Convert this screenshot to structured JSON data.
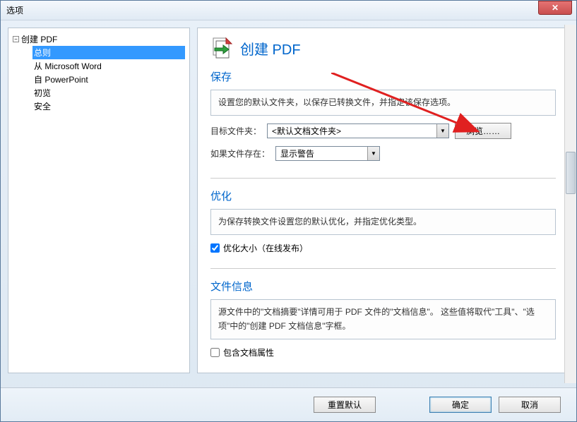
{
  "titlebar": {
    "title": "选项"
  },
  "tree": {
    "root": "创建 PDF",
    "items": [
      "总则",
      "从 Microsoft Word",
      "自 PowerPoint",
      "初览",
      "安全"
    ],
    "selected_index": 0
  },
  "header": {
    "title": "创建 PDF"
  },
  "save": {
    "title": "保存",
    "desc": "设置您的默认文件夹，以保存已转换文件，并指定该保存选项。",
    "target_label": "目标文件夹：",
    "target_value": "<默认文档文件夹>",
    "browse_label": "浏览……",
    "exists_label": "如果文件存在：",
    "exists_value": "显示警告"
  },
  "optimize": {
    "title": "优化",
    "desc": "为保存转换文件设置您的默认优化，并指定优化类型。",
    "chk_size_label": "优化大小（在线发布）",
    "chk_size_checked": true
  },
  "fileinfo": {
    "title": "文件信息",
    "desc": "源文件中的\"文档摘要\"详情可用于 PDF 文件的\"文档信息\"。 这些值将取代\"工具\"、\"选项\"中的\"创建 PDF 文档信息\"字框。",
    "chk_include_label": "包含文档属性",
    "chk_include_checked": false
  },
  "footer": {
    "reset": "重置默认",
    "ok": "确定",
    "cancel": "取消"
  }
}
